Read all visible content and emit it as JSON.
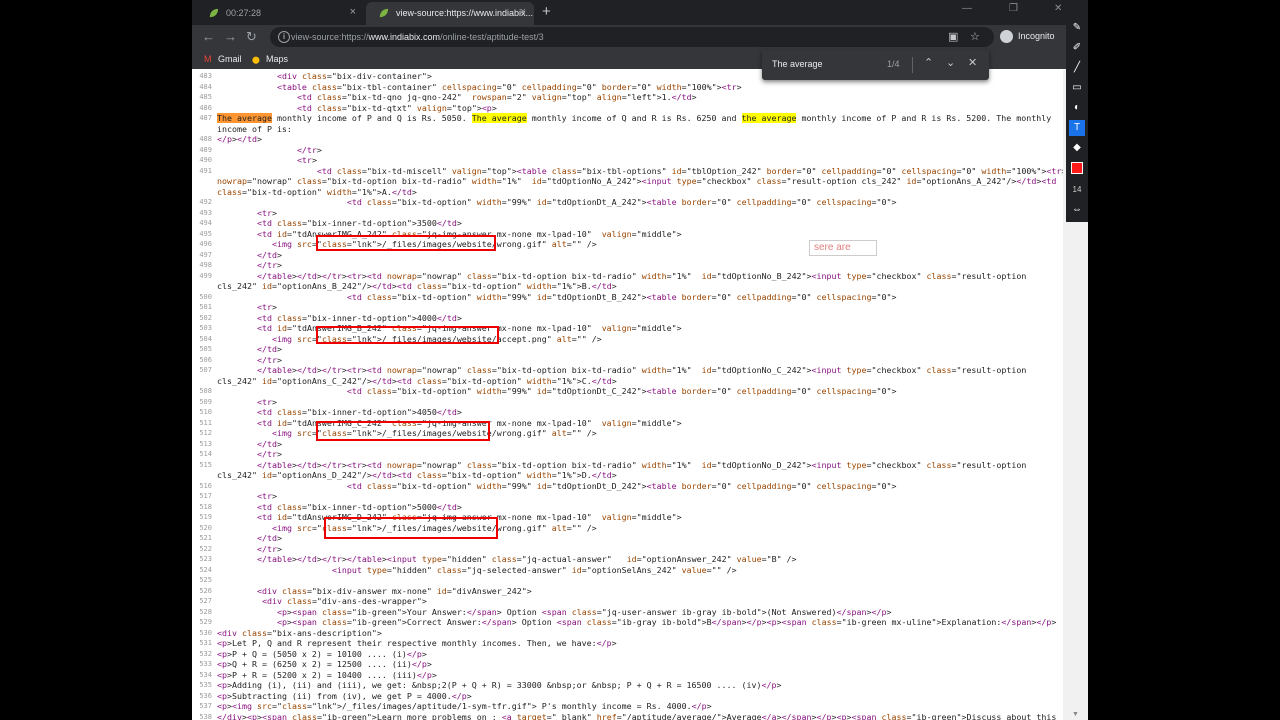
{
  "tabs": [
    {
      "title": "00:27:28",
      "active": false,
      "close": "×"
    },
    {
      "title": "view-source:https://www.indiabix...",
      "active": true,
      "close": "×"
    }
  ],
  "new_tab_glyph": "+",
  "window_controls": {
    "minimize": "—",
    "restore": "❐",
    "close": "✕"
  },
  "toolbar": {
    "back": "←",
    "forward": "→",
    "reload": "↻",
    "url_prefix": "view-source:https://",
    "url_host": "www.indiabix.com",
    "url_path": "/online-test/aptitude-test/3",
    "info_glyph": "i",
    "page_icon": "▣",
    "star": "☆",
    "profile_label": "Incognito",
    "menu": "⋮"
  },
  "bookmarks": [
    {
      "label": "Gmail",
      "icon": "gmail-icon",
      "glyph": "M"
    },
    {
      "label": "Maps",
      "icon": "maps-icon",
      "glyph": "⬤"
    }
  ],
  "findbar": {
    "query": "The average",
    "count": "1/4",
    "prev": "⌃",
    "next": "⌄",
    "close": "✕"
  },
  "overlay_text": "sere are",
  "annotation_tools": [
    {
      "icon": "pencil-icon",
      "glyph": "✎",
      "selected": false
    },
    {
      "icon": "marker-icon",
      "glyph": "✐",
      "selected": false
    },
    {
      "icon": "line-icon",
      "glyph": "╱",
      "selected": false
    },
    {
      "icon": "rectangle-icon",
      "glyph": "▭",
      "selected": false
    },
    {
      "icon": "eraser-icon",
      "glyph": "◐",
      "selected": false
    },
    {
      "icon": "text-icon",
      "glyph": "T",
      "selected": true
    },
    {
      "icon": "eraser-all-icon",
      "glyph": "◆",
      "selected": false
    }
  ],
  "annotation_color": "#ff1a1a",
  "annotation_size": "14",
  "annotation_more": "⇔",
  "line_numbers": [
    "483",
    "484",
    "485",
    "486",
    "487",
    "",
    "488",
    "489",
    "490",
    "491",
    "",
    "",
    "492",
    "493",
    "494",
    "495",
    "496",
    "497",
    "498",
    "499",
    "",
    "500",
    "501",
    "502",
    "503",
    "504",
    "505",
    "506",
    "507",
    "",
    "508",
    "509",
    "510",
    "511",
    "512",
    "513",
    "514",
    "515",
    "",
    "516",
    "517",
    "518",
    "519",
    "520",
    "521",
    "522",
    "523",
    "524",
    "525",
    "526",
    "527",
    "528",
    "529",
    "530",
    "531",
    "532",
    "533",
    "534",
    "535",
    "536",
    "537",
    "538"
  ],
  "code_lines": [
    "            <div class=\"bix-div-container\">",
    "            <table class=\"bix-tbl-container\" cellspacing=\"0\" cellpadding=\"0\" border=\"0\" width=\"100%\"><tr>",
    "                <td class=\"bix-td-qno jq-qno-242\"  rowspan=\"2\" valign=\"top\" align=\"left\">1.</td>",
    "                <td class=\"bix-td-qtxt\" valign=\"top\"><p>",
    "The average monthly income of P and Q is Rs. 5050. The average monthly income of Q and R is Rs. 6250 and the average monthly income of P and R is Rs. 5200. The monthly",
    "income of P is:",
    "</p></td>",
    "                </tr>",
    "                <tr>",
    "                    <td class=\"bix-td-miscell\" valign=\"top\"><table class=\"bix-tbl-options\" id=\"tblOption_242\" border=\"0\" cellpadding=\"0\" cellspacing=\"0\" width=\"100%\"><tr><td",
    "nowrap=\"nowrap\" class=\"bix-td-option bix-td-radio\" width=\"1%\"  id=\"tdOptionNo_A_242\"><input type=\"checkbox\" class=\"result-option cls_242\" id=\"optionAns_A_242\"/></td><td",
    "class=\"bix-td-option\" width=\"1%\">A.</td>",
    "                          <td class=\"bix-td-option\" width=\"99%\" id=\"tdOptionDt_A_242\"><table border=\"0\" cellpadding=\"0\" cellspacing=\"0\">",
    "        <tr>",
    "        <td class=\"bix-inner-td-option\">3500</td>",
    "        <td id=\"tdAnswerIMG_A_242\" class=\"jq-img-answer mx-none mx-lpad-10\"  valign=\"middle\">",
    "           <img src=\"/_files/images/website/wrong.gif\" alt=\"\" />",
    "        </td>",
    "        </tr>",
    "        </table></td></tr><tr><td nowrap=\"nowrap\" class=\"bix-td-option bix-td-radio\" width=\"1%\"  id=\"tdOptionNo_B_242\"><input type=\"checkbox\" class=\"result-option",
    "cls_242\" id=\"optionAns_B_242\"/></td><td class=\"bix-td-option\" width=\"1%\">B.</td>",
    "                          <td class=\"bix-td-option\" width=\"99%\" id=\"tdOptionDt_B_242\"><table border=\"0\" cellpadding=\"0\" cellspacing=\"0\">",
    "        <tr>",
    "        <td class=\"bix-inner-td-option\">4000</td>",
    "        <td id=\"tdAnswerIMG_B_242\" class=\"jq-img-answer mx-none mx-lpad-10\"  valign=\"middle\">",
    "           <img src=\"/_files/images/website/accept.png\" alt=\"\" />",
    "        </td>",
    "        </tr>",
    "        </table></td></tr><tr><td nowrap=\"nowrap\" class=\"bix-td-option bix-td-radio\" width=\"1%\"  id=\"tdOptionNo_C_242\"><input type=\"checkbox\" class=\"result-option",
    "cls_242\" id=\"optionAns_C_242\"/></td><td class=\"bix-td-option\" width=\"1%\">C.</td>",
    "                          <td class=\"bix-td-option\" width=\"99%\" id=\"tdOptionDt_C_242\"><table border=\"0\" cellpadding=\"0\" cellspacing=\"0\">",
    "        <tr>",
    "        <td class=\"bix-inner-td-option\">4050</td>",
    "        <td id=\"tdAnswerIMG_C_242\" class=\"jq-img-answer mx-none mx-lpad-10\"  valign=\"middle\">",
    "           <img src=\"/_files/images/website/wrong.gif\" alt=\"\" />",
    "        </td>",
    "        </tr>",
    "        </table></td></tr><tr><td nowrap=\"nowrap\" class=\"bix-td-option bix-td-radio\" width=\"1%\"  id=\"tdOptionNo_D_242\"><input type=\"checkbox\" class=\"result-option",
    "cls_242\" id=\"optionAns_D_242\"/></td><td class=\"bix-td-option\" width=\"1%\">D.</td>",
    "                          <td class=\"bix-td-option\" width=\"99%\" id=\"tdOptionDt_D_242\"><table border=\"0\" cellpadding=\"0\" cellspacing=\"0\">",
    "        <tr>",
    "        <td class=\"bix-inner-td-option\">5000</td>",
    "        <td id=\"tdAnswerIMG_D_242\" class=\"jq-img-answer mx-none mx-lpad-10\"  valign=\"middle\">",
    "           <img src=\"/_files/images/website/wrong.gif\" alt=\"\" />",
    "        </td>",
    "        </tr>",
    "        </table></td></tr></table><input type=\"hidden\" class=\"jq-actual-answer\"   id=\"optionAnswer_242\" value=\"B\" />",
    "                       <input type=\"hidden\" class=\"jq-selected-answer\" id=\"optionSelAns_242\" value=\"\" />",
    "",
    "        <div class=\"bix-div-answer mx-none\" id=\"divAnswer_242\">",
    "         <div class=\"div-ans-des-wrapper\">",
    "            <p><span class=\"ib-green\">Your Answer:</span> Option <span class=\"jq-user-answer ib-gray ib-bold\">(Not Answered)</span></p>",
    "            <p><span class=\"ib-green\">Correct Answer:</span> Option <span class=\"ib-gray ib-bold\">B</span></p><p><span class=\"ib-green mx-uline\">Explanation:</span></p>",
    "<div class=\"bix-ans-description\">",
    "<p>Let P, Q and R represent their respective monthly incomes. Then, we have:</p>",
    "<p>P + Q = (5050 x 2) = 10100 .... (i)</p>",
    "<p>Q + R = (6250 x 2) = 12500 .... (ii)</p>",
    "<p>P + R = (5200 x 2) = 10400 .... (iii)</p>",
    "<p>Adding (i), (ii) and (iii), we get: &nbsp;2(P + Q + R) = 33000 &nbsp;or &nbsp; P + Q + R = 16500 .... (iv)</p>",
    "<p>Subtracting (ii) from (iv), we get P = 4000.</p>",
    "<p><img src=\"/_files/images/aptitude/1-sym-tfr.gif\"> P's monthly income = Rs. 4000.</p>",
    "</div><p><span class=\"ib-green\">Learn more problems on : <a target=\"_blank\" href=\"/aptitude/average/\">Average</a></span></p><p><span class=\"ib-green\">Discuss about this"
  ]
}
